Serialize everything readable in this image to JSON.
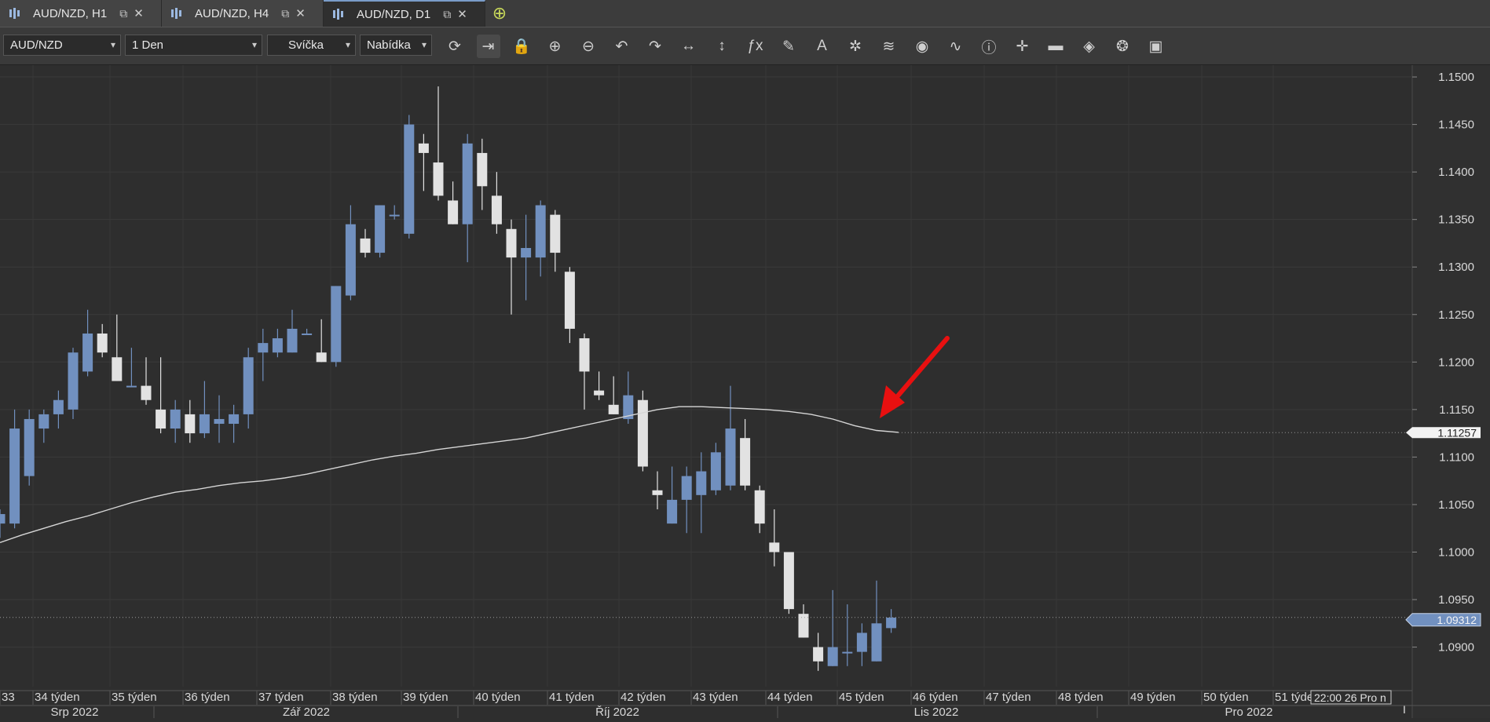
{
  "tabs": [
    {
      "label": "AUD/NZD, H1",
      "active": false
    },
    {
      "label": "AUD/NZD, H4",
      "active": false
    },
    {
      "label": "AUD/NZD, D1",
      "active": true
    }
  ],
  "tab_icons": {
    "chart": "candles-icon",
    "popout": "popout-icon",
    "close": "close-icon",
    "add": "add-chart-icon"
  },
  "toolbar": {
    "symbol": "AUD/NZD",
    "timeframe": "1 Den",
    "chart_type": "Svíčka",
    "price_type": "Nabídka",
    "tools": [
      "refresh-icon",
      "autoscroll-icon",
      "lock-icon",
      "zoom-in-icon",
      "zoom-out-icon",
      "undo-icon",
      "redo-icon",
      "fit-horizontal-icon",
      "fit-vertical-icon",
      "indicators-icon",
      "drawing-icon",
      "text-tool-icon",
      "objects-icon",
      "layers-icon",
      "visibility-icon",
      "alerts-icon",
      "info-icon",
      "crosshair-icon",
      "color-scheme-icon",
      "fill-icon",
      "templates-icon",
      "save-icon"
    ]
  },
  "chart_data": {
    "type": "candlestick",
    "symbol": "AUD/NZD",
    "timeframe": "D1",
    "y_ticks": [
      "1.1500",
      "1.1450",
      "1.1400",
      "1.1350",
      "1.1300",
      "1.1250",
      "1.1200",
      "1.1150",
      "1.1100",
      "1.1050",
      "1.1000",
      "1.0950",
      "1.0900"
    ],
    "ylim": [
      1.086,
      1.1505
    ],
    "price_labels": {
      "moving_average": "1.11257",
      "bid": "1.09312"
    },
    "moving_average_last": 1.11257,
    "bid_price": 1.09312,
    "week_labels": [
      "33",
      "34 týden",
      "35 týden",
      "36 týden",
      "37 týden",
      "38 týden",
      "39 týden",
      "40 týden",
      "41 týden",
      "42 týden",
      "43 týden",
      "44 týden",
      "45 týden",
      "46 týden",
      "47 týden",
      "48 týden",
      "49 týden",
      "50 týden",
      "51 týden"
    ],
    "month_labels": [
      "Srp 2022",
      "Zář 2022",
      "Říj 2022",
      "Lis 2022",
      "Pro 2022"
    ],
    "crosshair_time": "22:00 26 Pro n",
    "candles": [
      {
        "o": 1.103,
        "h": 1.1045,
        "l": 1.1015,
        "c": 1.104
      },
      {
        "o": 1.103,
        "h": 1.115,
        "l": 1.1025,
        "c": 1.113
      },
      {
        "o": 1.108,
        "h": 1.115,
        "l": 1.107,
        "c": 1.114
      },
      {
        "o": 1.113,
        "h": 1.115,
        "l": 1.1115,
        "c": 1.1145
      },
      {
        "o": 1.1145,
        "h": 1.117,
        "l": 1.113,
        "c": 1.116
      },
      {
        "o": 1.115,
        "h": 1.1215,
        "l": 1.114,
        "c": 1.121
      },
      {
        "o": 1.119,
        "h": 1.1255,
        "l": 1.1185,
        "c": 1.123
      },
      {
        "o": 1.123,
        "h": 1.124,
        "l": 1.1205,
        "c": 1.121
      },
      {
        "o": 1.1205,
        "h": 1.125,
        "l": 1.118,
        "c": 1.118
      },
      {
        "o": 1.1175,
        "h": 1.1215,
        "l": 1.1175,
        "c": 1.1175
      },
      {
        "o": 1.1175,
        "h": 1.1205,
        "l": 1.1155,
        "c": 1.116
      },
      {
        "o": 1.115,
        "h": 1.1205,
        "l": 1.1125,
        "c": 1.113
      },
      {
        "o": 1.113,
        "h": 1.116,
        "l": 1.1115,
        "c": 1.115
      },
      {
        "o": 1.1145,
        "h": 1.116,
        "l": 1.1115,
        "c": 1.1125
      },
      {
        "o": 1.1125,
        "h": 1.118,
        "l": 1.112,
        "c": 1.1145
      },
      {
        "o": 1.1135,
        "h": 1.1165,
        "l": 1.1115,
        "c": 1.114
      },
      {
        "o": 1.1135,
        "h": 1.1155,
        "l": 1.1115,
        "c": 1.1145
      },
      {
        "o": 1.1145,
        "h": 1.1215,
        "l": 1.113,
        "c": 1.1205
      },
      {
        "o": 1.121,
        "h": 1.1235,
        "l": 1.118,
        "c": 1.122
      },
      {
        "o": 1.121,
        "h": 1.1235,
        "l": 1.1205,
        "c": 1.1225
      },
      {
        "o": 1.121,
        "h": 1.1255,
        "l": 1.121,
        "c": 1.1235
      },
      {
        "o": 1.123,
        "h": 1.1235,
        "l": 1.123,
        "c": 1.123
      },
      {
        "o": 1.121,
        "h": 1.1245,
        "l": 1.12,
        "c": 1.12
      },
      {
        "o": 1.12,
        "h": 1.128,
        "l": 1.1195,
        "c": 1.128
      },
      {
        "o": 1.127,
        "h": 1.1365,
        "l": 1.1265,
        "c": 1.1345
      },
      {
        "o": 1.133,
        "h": 1.134,
        "l": 1.131,
        "c": 1.1315
      },
      {
        "o": 1.1315,
        "h": 1.1365,
        "l": 1.131,
        "c": 1.1365
      },
      {
        "o": 1.1355,
        "h": 1.1365,
        "l": 1.135,
        "c": 1.1355
      },
      {
        "o": 1.1335,
        "h": 1.146,
        "l": 1.133,
        "c": 1.145
      },
      {
        "o": 1.143,
        "h": 1.144,
        "l": 1.138,
        "c": 1.142
      },
      {
        "o": 1.141,
        "h": 1.149,
        "l": 1.137,
        "c": 1.1375
      },
      {
        "o": 1.137,
        "h": 1.139,
        "l": 1.1345,
        "c": 1.1345
      },
      {
        "o": 1.1345,
        "h": 1.144,
        "l": 1.1305,
        "c": 1.143
      },
      {
        "o": 1.142,
        "h": 1.1435,
        "l": 1.136,
        "c": 1.1385
      },
      {
        "o": 1.1375,
        "h": 1.14,
        "l": 1.1335,
        "c": 1.1345
      },
      {
        "o": 1.134,
        "h": 1.135,
        "l": 1.125,
        "c": 1.131
      },
      {
        "o": 1.131,
        "h": 1.1355,
        "l": 1.1265,
        "c": 1.132
      },
      {
        "o": 1.131,
        "h": 1.137,
        "l": 1.129,
        "c": 1.1365
      },
      {
        "o": 1.1355,
        "h": 1.136,
        "l": 1.1295,
        "c": 1.1315
      },
      {
        "o": 1.1295,
        "h": 1.13,
        "l": 1.122,
        "c": 1.1235
      },
      {
        "o": 1.1225,
        "h": 1.123,
        "l": 1.115,
        "c": 1.119
      },
      {
        "o": 1.117,
        "h": 1.119,
        "l": 1.116,
        "c": 1.1165
      },
      {
        "o": 1.1155,
        "h": 1.1185,
        "l": 1.1145,
        "c": 1.1145
      },
      {
        "o": 1.114,
        "h": 1.119,
        "l": 1.1135,
        "c": 1.1165
      },
      {
        "o": 1.116,
        "h": 1.117,
        "l": 1.1085,
        "c": 1.109
      },
      {
        "o": 1.1065,
        "h": 1.1085,
        "l": 1.1045,
        "c": 1.106
      },
      {
        "o": 1.103,
        "h": 1.109,
        "l": 1.103,
        "c": 1.1055
      },
      {
        "o": 1.1055,
        "h": 1.109,
        "l": 1.102,
        "c": 1.108
      },
      {
        "o": 1.106,
        "h": 1.1105,
        "l": 1.102,
        "c": 1.1085
      },
      {
        "o": 1.1065,
        "h": 1.1115,
        "l": 1.106,
        "c": 1.1105
      },
      {
        "o": 1.107,
        "h": 1.1175,
        "l": 1.1065,
        "c": 1.113
      },
      {
        "o": 1.112,
        "h": 1.114,
        "l": 1.1065,
        "c": 1.107
      },
      {
        "o": 1.1065,
        "h": 1.107,
        "l": 1.102,
        "c": 1.103
      },
      {
        "o": 1.101,
        "h": 1.1045,
        "l": 1.0985,
        "c": 1.1
      },
      {
        "o": 1.1,
        "h": 1.1,
        "l": 1.0935,
        "c": 1.094
      },
      {
        "o": 1.0935,
        "h": 1.0945,
        "l": 1.091,
        "c": 1.091
      },
      {
        "o": 1.09,
        "h": 1.0915,
        "l": 1.0875,
        "c": 1.0885
      },
      {
        "o": 1.088,
        "h": 1.096,
        "l": 1.088,
        "c": 1.09
      },
      {
        "o": 1.0895,
        "h": 1.0945,
        "l": 1.088,
        "c": 1.0895
      },
      {
        "o": 1.0895,
        "h": 1.0925,
        "l": 1.088,
        "c": 1.0915
      },
      {
        "o": 1.0885,
        "h": 1.097,
        "l": 1.0885,
        "c": 1.0925
      },
      {
        "o": 1.092,
        "h": 1.094,
        "l": 1.0915,
        "c": 1.0931
      }
    ],
    "moving_average": [
      1.101,
      1.1018,
      1.1025,
      1.1032,
      1.1038,
      1.1045,
      1.1052,
      1.1058,
      1.1063,
      1.1066,
      1.107,
      1.1073,
      1.1075,
      1.1078,
      1.1082,
      1.1087,
      1.1092,
      1.1097,
      1.1101,
      1.1104,
      1.1108,
      1.1111,
      1.1114,
      1.1117,
      1.112,
      1.1125,
      1.113,
      1.1135,
      1.114,
      1.1145,
      1.115,
      1.1153,
      1.1153,
      1.1152,
      1.1151,
      1.115,
      1.1148,
      1.1145,
      1.114,
      1.1133,
      1.1128,
      1.1126
    ]
  }
}
